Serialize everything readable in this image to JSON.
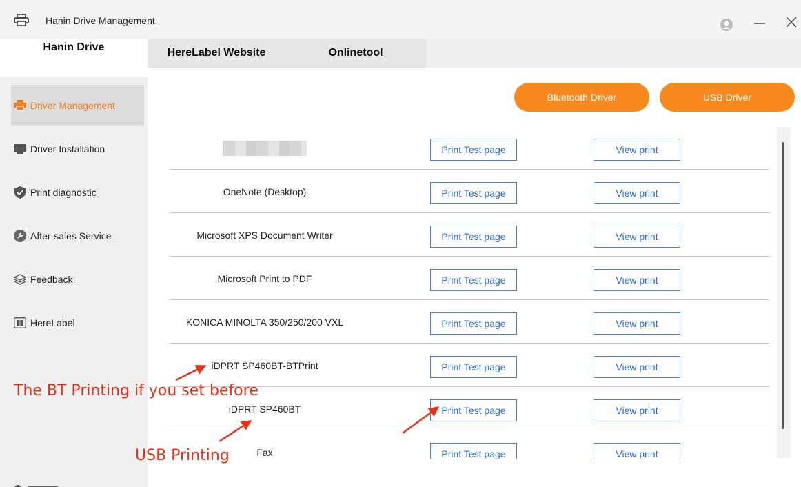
{
  "window": {
    "title": "Hanin Drive Management",
    "icons": {
      "app": "printer-icon",
      "user": "user-avatar-icon",
      "minimize": "minimize-icon",
      "close": "close-icon"
    }
  },
  "tabs": [
    {
      "label": "Hanin Drive",
      "active": true
    },
    {
      "label": "HereLabel Website",
      "active": false
    },
    {
      "label": "Onlinetool",
      "active": false
    }
  ],
  "sidebar": {
    "items": [
      {
        "label": "Driver Management",
        "icon": "printer-icon",
        "active": true
      },
      {
        "label": "Driver Installation",
        "icon": "monitor-icon",
        "active": false
      },
      {
        "label": "Print diagnostic",
        "icon": "shield-icon",
        "active": false
      },
      {
        "label": "After-sales Service",
        "icon": "wrench-icon",
        "active": false
      },
      {
        "label": "Feedback",
        "icon": "layers-icon",
        "active": false
      },
      {
        "label": "HereLabel",
        "icon": "barcode-icon",
        "active": false
      }
    ]
  },
  "actions": {
    "bluetooth_label": "Bluetooth Driver",
    "usb_label": "USB Driver"
  },
  "printers": {
    "test_label": "Print Test page",
    "view_label": "View print",
    "rows": [
      {
        "name": "",
        "blurred": true
      },
      {
        "name": "OneNote (Desktop)"
      },
      {
        "name": "Microsoft XPS Document Writer"
      },
      {
        "name": "Microsoft Print to PDF"
      },
      {
        "name": "KONICA MINOLTA 350/250/200 VXL"
      },
      {
        "name": "iDPRT SP460BT-BTPrint"
      },
      {
        "name": "iDPRT SP460BT"
      },
      {
        "name": "Fax"
      }
    ]
  },
  "annotations": {
    "bt_note": "The BT Printing if you set before",
    "usb_note": "USB Printing",
    "color": "#e8311a"
  },
  "colors": {
    "accent": "#f7891f",
    "link_blue": "#2f6bd8"
  }
}
